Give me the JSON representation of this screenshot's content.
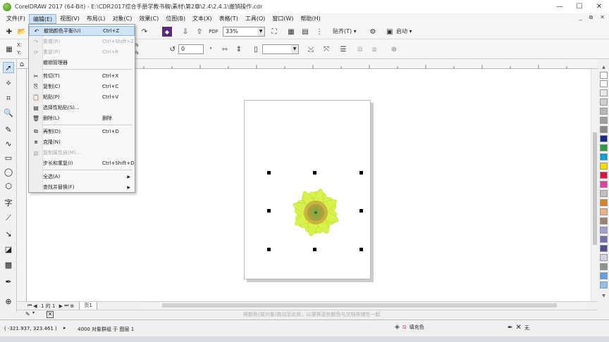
{
  "title": "CorelDRAW 2017 (64-Bit) - E:\\CDR2017综合手册学教书稿\\素材\\第2章\\2.4\\2.4.1\\撤销操作.cdr",
  "menubar": [
    "文件(F)",
    "编辑(E)",
    "视图(V)",
    "布局(L)",
    "对象(C)",
    "效果(C)",
    "位图(B)",
    "文本(X)",
    "表格(T)",
    "工具(O)",
    "窗口(W)",
    "帮助(H)"
  ],
  "menu_min": [
    "_",
    "⧉",
    "✕"
  ],
  "toolbar": {
    "zoom": "33%",
    "snap_label": "贴齐(T)",
    "launch_label": "启动",
    "angle": "0",
    "x_label": "X:",
    "y_label": "Y:"
  },
  "edit_menu": [
    {
      "label": "撤销颜色平衡(U)",
      "shortcut": "Ctrl+Z",
      "icon": "undo-icon",
      "highlight": true
    },
    {
      "label": "重做(R)",
      "shortcut": "Ctrl+Shift+Z",
      "icon": "redo-icon",
      "disabled": true
    },
    {
      "label": "重复(R)",
      "shortcut": "Ctrl+R",
      "icon": "repeat-icon",
      "disabled": true
    },
    {
      "label": "撤销管理器",
      "shortcut": "",
      "icon": "",
      "sep_after": true
    },
    {
      "label": "剪切(T)",
      "shortcut": "Ctrl+X",
      "icon": "cut-icon"
    },
    {
      "label": "复制(C)",
      "shortcut": "Ctrl+C",
      "icon": "copy-icon"
    },
    {
      "label": "粘贴(P)",
      "shortcut": "Ctrl+V",
      "icon": "paste-icon"
    },
    {
      "label": "选择性粘贴(S)...",
      "shortcut": "",
      "icon": "paste-special-icon"
    },
    {
      "label": "删除(L)",
      "shortcut": "删除",
      "icon": "trash-icon",
      "sep_after": true
    },
    {
      "label": "再制(D)",
      "shortcut": "Ctrl+D",
      "icon": "duplicate-icon"
    },
    {
      "label": "克隆(N)",
      "shortcut": "",
      "icon": "clone-icon"
    },
    {
      "label": "复制属性自(M)...",
      "shortcut": "",
      "icon": "copy-properties-icon",
      "disabled": true
    },
    {
      "label": "步长和重复(I)",
      "shortcut": "Ctrl+Shift+D",
      "icon": "",
      "sep_after": true
    },
    {
      "label": "全选(A)",
      "shortcut": "",
      "icon": "",
      "submenu": true
    },
    {
      "label": "查找并替换(F)",
      "shortcut": "",
      "icon": "",
      "submenu": true
    }
  ],
  "pagebar": {
    "page_of": "1 的 1",
    "page_tab": "页1"
  },
  "hint": "将颜色(或对象)拖动至此处，以便将这些颜色与文档存储在一起",
  "status": {
    "coords": "( -321.937, 323.461 )",
    "object_info": "4000 对象群组 于 图层 1",
    "fill_label": "填充色",
    "outline_label": "无"
  },
  "colors": {
    "accent": "#cfe3f6",
    "flower": "#d9f24a",
    "palette": [
      "#ffffff",
      "#e8e8e8",
      "#d0d0d0",
      "#b8b8b8",
      "#a0a0a0",
      "#888888",
      "#1a2a8a",
      "#2aa040",
      "#00a0e0",
      "#f0e000",
      "#e01040",
      "#e040a0",
      "#c0c0c0",
      "#e08020",
      "#f0b080",
      "#a08070",
      "#a0a0d0",
      "#7070b0",
      "#505090",
      "#d0d0e8",
      "#909090",
      "#60a0e0",
      "#90c0f0"
    ]
  }
}
